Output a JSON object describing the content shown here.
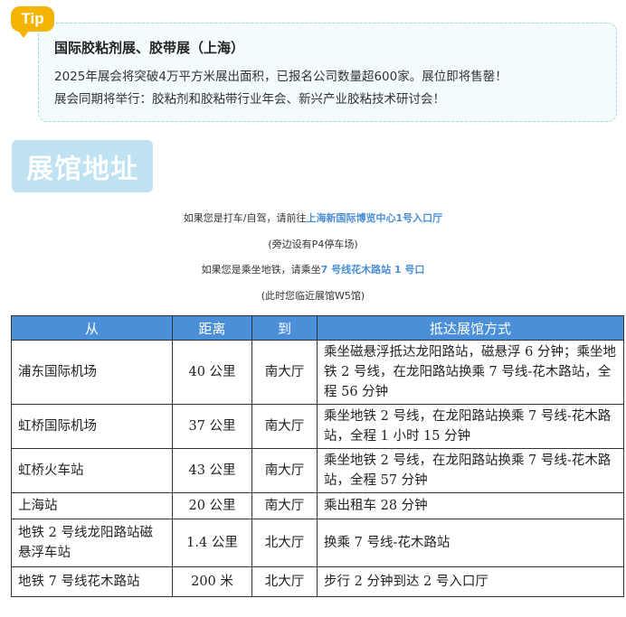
{
  "tip": {
    "tag": "Tip",
    "title": "国际胶粘剂展、胶带展（上海）",
    "lines": [
      "2025年展会将突破4万平方米展出面积，已报名公司数量超600家。展位即将售罄！",
      "展会同期将举行：胶粘剂和胶粘带行业年会、新兴产业胶粘技术研讨会！"
    ]
  },
  "section": {
    "title": "展馆地址"
  },
  "directions": {
    "taxi_prefix": "如果您是打车/自驾，请前往",
    "taxi_highlight": "上海新国际博览中心1号入口厅",
    "taxi_note": "(旁边设有P4停车场)",
    "metro_prefix": "如果您是乘坐地铁，请乘坐",
    "metro_highlight": "7 号线花木路站 1 号口",
    "metro_note": "(此时您临近展馆W5馆)"
  },
  "table": {
    "headers": [
      "从",
      "距离",
      "到",
      "抵达展馆方式"
    ],
    "rows": [
      {
        "from": "浦东国际机场",
        "distance": "40 公里",
        "to": "南大厅",
        "method": "乘坐磁悬浮抵达龙阳路站，磁悬浮 6 分钟；乘坐地铁 2 号线，在龙阳路站换乘 7 号线-花木路站，全程 56 分钟"
      },
      {
        "from": "虹桥国际机场",
        "distance": "37 公里",
        "to": "南大厅",
        "method": "乘坐地铁 2 号线，在龙阳路站换乘 7 号线-花木路站，全程 1 小时 15 分钟"
      },
      {
        "from": "虹桥火车站",
        "distance": "43 公里",
        "to": "南大厅",
        "method": "乘坐地铁 2 号线，在龙阳路站换乘 7 号线-花木路站，全程 57 分钟"
      },
      {
        "from": "上海站",
        "distance": "20 公里",
        "to": "南大厅",
        "method": "乘出租车 28 分钟"
      },
      {
        "from": "地铁 2 号线龙阳路站磁悬浮车站",
        "distance": "1.4 公里",
        "to": "北大厅",
        "method": "换乘 7 号线-花木路站"
      },
      {
        "from": "地铁 7 号线花木路站",
        "distance": "200 米",
        "to": "北大厅",
        "method": "步行 2 分钟到达 2 号入口厅"
      }
    ]
  }
}
